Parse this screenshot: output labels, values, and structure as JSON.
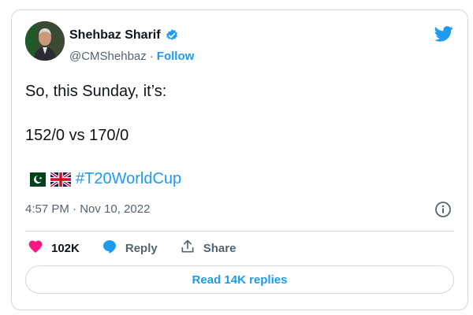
{
  "author": {
    "name": "Shehbaz Sharif",
    "handle": "@CMShehbaz",
    "separator": "·",
    "follow_label": "Follow"
  },
  "tweet": {
    "line1": "So, this Sunday, it’s:",
    "line2": "152/0 vs 170/0",
    "hashtag": "#T20WorldCup",
    "timestamp": "4:57 PM · Nov 10, 2022"
  },
  "actions": {
    "like_count": "102K",
    "reply_label": "Reply",
    "share_label": "Share"
  },
  "replies_button": "Read 14K replies",
  "icons": {
    "logo": "twitter-bird-icon",
    "verified": "verified-badge-icon",
    "info": "info-icon",
    "like": "heart-icon",
    "reply": "speech-bubble-icon",
    "share": "upload-arrow-icon",
    "flags": [
      "pakistan-flag-icon",
      "uk-flag-icon"
    ]
  },
  "colors": {
    "accent": "#1d9bf0",
    "like": "#f91880",
    "text": "#0f1419",
    "secondary": "#536471",
    "border": "#cfd9de"
  }
}
